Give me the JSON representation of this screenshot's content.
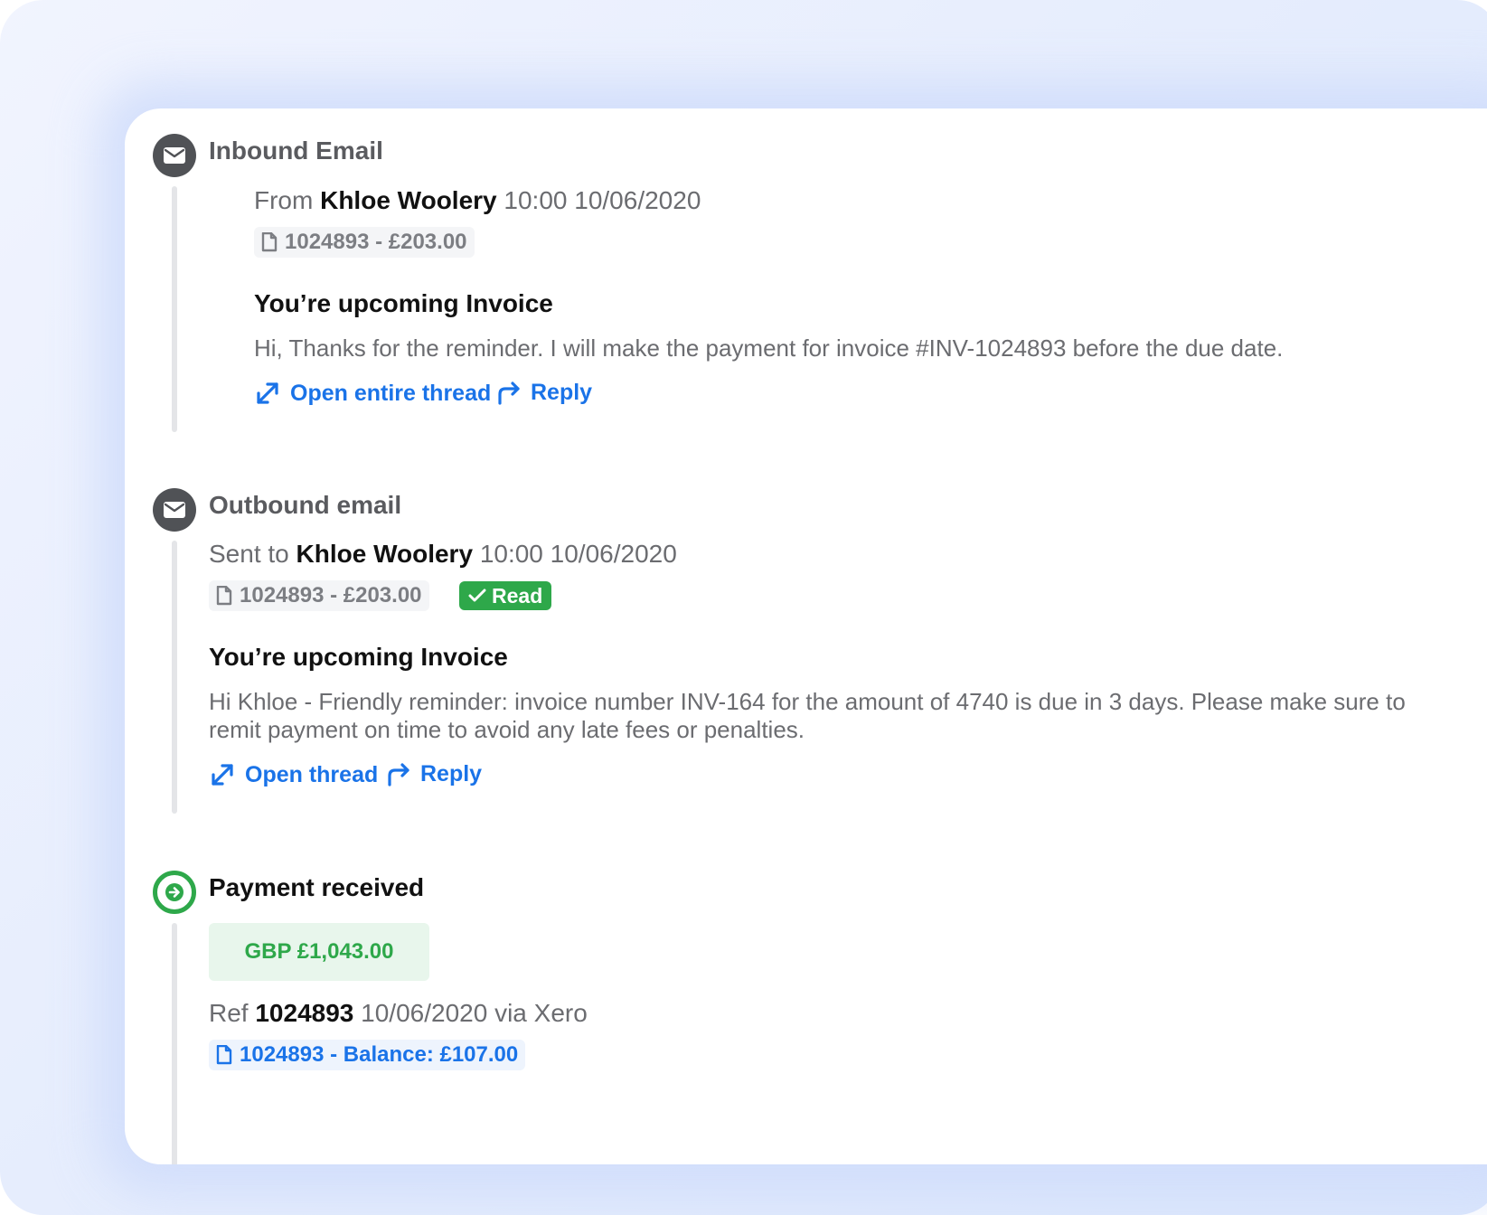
{
  "events": [
    {
      "title": "Inbound Email",
      "icon": "envelope-icon",
      "prefix": "From",
      "contact": "Khloe Woolery",
      "datetime": "10:00 10/06/2020",
      "invoice_chip": "1024893 - £203.00",
      "subject": "You’re upcoming Invoice",
      "body": "Hi, Thanks for the reminder. I will make the payment for invoice #INV-1024893 before the due date.",
      "actions": [
        {
          "label": "Open entire thread",
          "icon": "expand-icon"
        },
        {
          "label": "Reply",
          "icon": "reply-arrow-icon"
        }
      ]
    },
    {
      "title": "Outbound email",
      "icon": "envelope-icon",
      "prefix": "Sent to",
      "contact": "Khloe Woolery",
      "datetime": "10:00 10/06/2020",
      "invoice_chip": "1024893 - £203.00",
      "status_badge": "Read",
      "subject": "You’re upcoming Invoice",
      "body_line1": "Hi Khloe - Friendly reminder: invoice number INV-164 for the amount of 4740 is due in 3 days. Please make sure to",
      "body_line2": "remit payment on time to avoid any late fees or penalties.",
      "actions": [
        {
          "label": "Open thread",
          "icon": "expand-icon"
        },
        {
          "label": "Reply",
          "icon": "reply-arrow-icon"
        }
      ]
    },
    {
      "title": "Payment received",
      "icon": "arrow-right-circle-icon",
      "amount": "GBP £1,043.00",
      "ref_prefix": "Ref",
      "ref_number": "1024893",
      "ref_suffix": "10/06/2020 via Xero",
      "balance_chip": "1024893 - Balance: £107.00"
    }
  ],
  "colors": {
    "link": "#1a73e8",
    "success": "#2ea84a",
    "icon_dark": "#505256",
    "muted_text": "#6b6c70"
  }
}
